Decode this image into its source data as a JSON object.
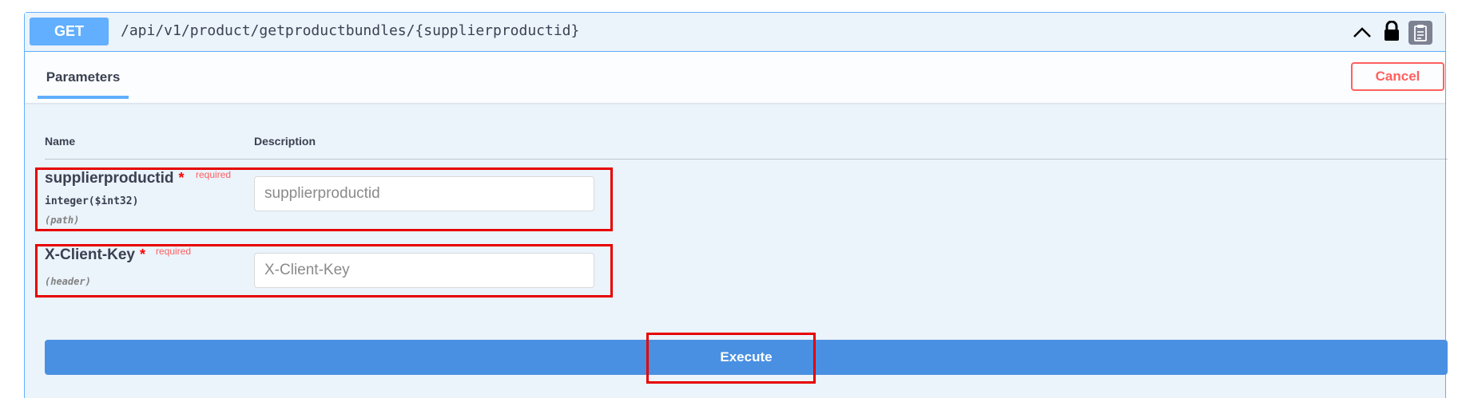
{
  "operation": {
    "method": "GET",
    "path": "/api/v1/product/getproductbundles/{supplierproductid}"
  },
  "icons": {
    "collapse": "chevron-up-icon",
    "lock": "lock-icon",
    "copy": "clipboard-copy-icon"
  },
  "tabs": {
    "parameters": "Parameters"
  },
  "buttons": {
    "cancel": "Cancel",
    "execute": "Execute"
  },
  "table": {
    "col_name": "Name",
    "col_description": "Description"
  },
  "parameters": [
    {
      "name": "supplierproductid",
      "required_star": "*",
      "required_text": "required",
      "type": "integer($int32)",
      "in": "(path)",
      "placeholder": "supplierproductid",
      "value": ""
    },
    {
      "name": "X-Client-Key",
      "required_star": "*",
      "required_text": "required",
      "in": "(header)",
      "placeholder": "X-Client-Key",
      "value": ""
    }
  ],
  "colors": {
    "get_accent": "#61affe",
    "execute_bg": "#4990e2",
    "cancel": "#ff6060",
    "highlight_box": "#e60000"
  }
}
